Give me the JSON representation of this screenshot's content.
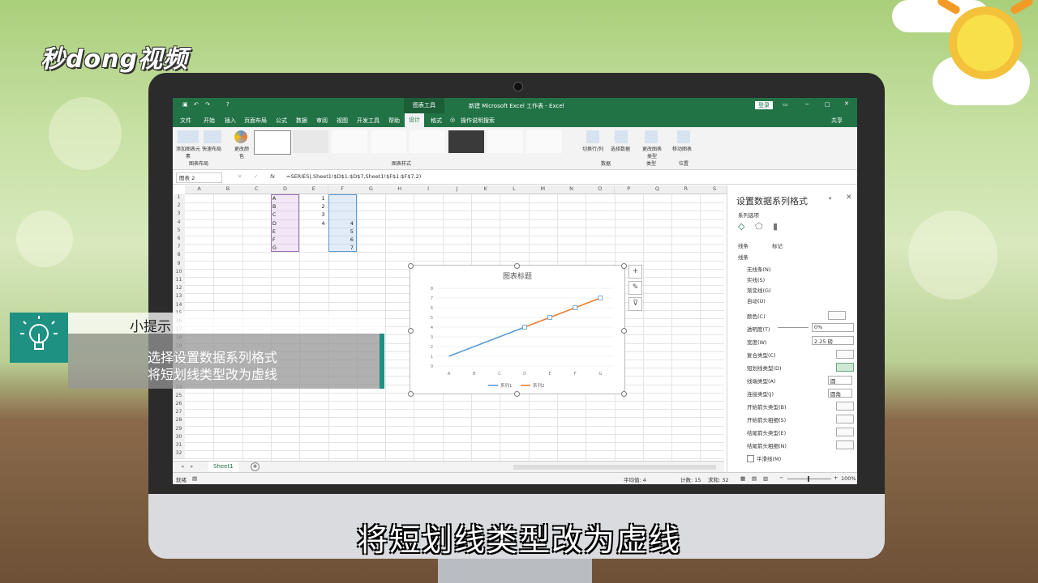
{
  "brand": {
    "logo": "秒dong视频"
  },
  "excel": {
    "title_center": "新建 Microsoft Excel 工作表 - Excel",
    "chart_tools_label": "图表工具",
    "login_label": "登录",
    "share_label": "共享",
    "tabs": [
      "文件",
      "开始",
      "插入",
      "页面布局",
      "公式",
      "数据",
      "审阅",
      "视图",
      "开发工具",
      "帮助",
      "设计",
      "格式"
    ],
    "search_label": "操作说明搜索",
    "ribbon": {
      "add_chart_element": "添加图表元素",
      "quick_layout": "快速布局",
      "change_colors": "更改颜色",
      "group_layout": "图表布局",
      "group_styles": "图表样式",
      "switch_row_col": "切换行/列",
      "select_data": "选择数据",
      "group_data": "数据",
      "change_chart_type": "更改图表类型",
      "group_type": "类型",
      "move_chart": "移动图表",
      "group_location": "位置"
    },
    "name_box": "图表 2",
    "formula": "=SERIES(,Sheet1!$D$1:$D$7,Sheet1!$F$1:$F$7,2)",
    "fx": "fx",
    "columns": [
      "A",
      "B",
      "C",
      "D",
      "E",
      "F",
      "G",
      "H",
      "I",
      "J",
      "K",
      "L",
      "M",
      "N",
      "O",
      "P",
      "Q",
      "R",
      "S"
    ],
    "rows": [
      "1",
      "2",
      "3",
      "4",
      "5",
      "6",
      "7",
      "8",
      "9",
      "10",
      "11",
      "12",
      "13",
      "14",
      "15",
      "16",
      "17",
      "18",
      "19",
      "20",
      "21",
      "22",
      "23",
      "24",
      "25",
      "26",
      "27",
      "28",
      "29",
      "30",
      "31",
      "32"
    ],
    "col_d": [
      "A",
      "B",
      "C",
      "D",
      "E",
      "F",
      "G"
    ],
    "col_e": [
      "1",
      "2",
      "3",
      "4"
    ],
    "col_f": [
      "4",
      "5",
      "6",
      "7"
    ],
    "sheet_tab": "Sheet1",
    "status": {
      "ready": "就绪",
      "average": "平均值: 4",
      "count": "计数: 15",
      "sum": "求和: 32",
      "zoom": "100%"
    }
  },
  "pane": {
    "title": "设置数据系列格式",
    "series_options": "系列选项",
    "tab_line": "线条",
    "tab_marker": "标记",
    "section_line": "线条",
    "radio_none": "无线条(N)",
    "radio_solid": "实线(S)",
    "radio_gradient": "渐变线(G)",
    "radio_auto": "自动(U)",
    "color": "颜色(C)",
    "transparency": "透明度(T)",
    "transparency_value": "0%",
    "width": "宽度(W)",
    "width_value": "2.25 磅",
    "compound": "复合类型(C)",
    "dash": "短划线类型(D)",
    "cap": "线端类型(A)",
    "cap_value": "圆",
    "join": "连接类型(J)",
    "join_value": "圆角",
    "begin_arrow_type": "开始箭头类型(B)",
    "begin_arrow_size": "开始箭头粗细(S)",
    "end_arrow_type": "结尾箭头类型(E)",
    "end_arrow_size": "结尾箭头粗细(N)",
    "smooth": "平滑线(M)"
  },
  "chart_data": {
    "type": "line",
    "title": "图表标题",
    "categories": [
      "A",
      "B",
      "C",
      "D",
      "E",
      "F",
      "G"
    ],
    "ylim": [
      0,
      8
    ],
    "yticks": [
      "0",
      "1",
      "2",
      "3",
      "4",
      "5",
      "6",
      "7",
      "8"
    ],
    "series": [
      {
        "name": "系列1",
        "color": "#5b9bd5",
        "values": [
          1,
          2,
          3,
          4,
          null,
          null,
          null
        ]
      },
      {
        "name": "系列2",
        "color": "#ed7d31",
        "values": [
          null,
          null,
          null,
          4,
          5,
          6,
          7
        ]
      }
    ]
  },
  "tip": {
    "title": "小提示",
    "line1": "选择设置数据系列格式",
    "line2": "将短划线类型改为虚线"
  },
  "subtitle": "将短划线类型改为虚线"
}
